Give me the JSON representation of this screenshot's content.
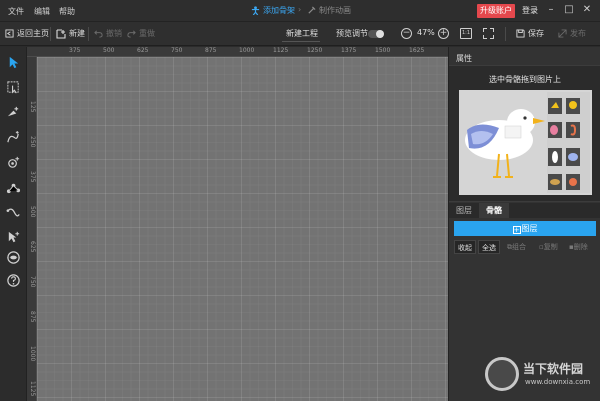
{
  "menubar": {
    "menus": [
      "文件",
      "编辑",
      "帮助"
    ],
    "steps": [
      {
        "label": "添加骨架",
        "active": true
      },
      {
        "label": "制作动画",
        "active": false
      }
    ],
    "upgrade_label": "升级账户",
    "login_label": "登录"
  },
  "toolbar": {
    "back_label": "返回主页",
    "new_label": "新建",
    "undo_label": "撤销",
    "redo_label": "重做",
    "project_title": "新建工程",
    "preview_adjust_label": "预览调节",
    "zoom_value": "47%",
    "fit_label": "1:1",
    "save_label": "保存",
    "publish_label": "发布"
  },
  "rulers": {
    "horizontal": [
      "375",
      "500",
      "625",
      "750",
      "875",
      "1000",
      "1125",
      "1250",
      "1375",
      "1500",
      "1625"
    ],
    "vertical": [
      "125",
      "250",
      "375",
      "500",
      "625",
      "750",
      "875",
      "1000",
      "1125"
    ]
  },
  "properties": {
    "title": "属性",
    "hint": "选中骨骼拖到图片上"
  },
  "tabs": [
    {
      "label": "图层",
      "active": false
    },
    {
      "label": "骨骼",
      "active": true
    }
  ],
  "layers": {
    "add_label": "图层",
    "actions": [
      {
        "label": "收起",
        "enabled": true
      },
      {
        "label": "全选",
        "enabled": true
      },
      {
        "label": "组合",
        "enabled": false
      },
      {
        "label": "复制",
        "enabled": false
      },
      {
        "label": "删除",
        "enabled": false
      }
    ]
  },
  "watermark": {
    "title": "当下软件园",
    "url": "www.downxia.com"
  },
  "colors": {
    "accent": "#2aa4ef",
    "upgrade": "#e5484d",
    "canvas": "#737373"
  }
}
